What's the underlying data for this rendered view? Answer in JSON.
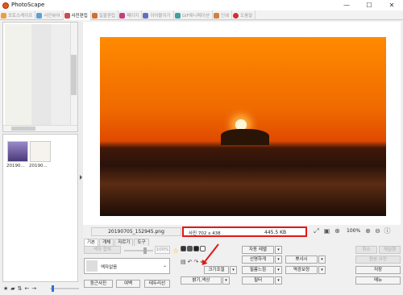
{
  "window": {
    "title": "PhotoScape",
    "minimize": "—",
    "maximize": "☐",
    "close": "✕"
  },
  "tabs": [
    {
      "label": "포토스케이프",
      "color": "#e8a040",
      "active": false
    },
    {
      "label": "사진뷰어",
      "color": "#5aa0d8",
      "active": false
    },
    {
      "label": "사진편집",
      "color": "#c85050",
      "active": true
    },
    {
      "label": "일괄편집",
      "color": "#d07030",
      "active": false
    },
    {
      "label": "페이지",
      "color": "#c04080",
      "active": false
    },
    {
      "label": "이어붙이기",
      "color": "#6070c0",
      "active": false
    },
    {
      "label": "GIF애니메이션",
      "color": "#40a0a0",
      "active": false
    },
    {
      "label": "인쇄",
      "color": "#d08040",
      "active": false
    },
    {
      "label": "도움말",
      "color": "#d03030",
      "active": false
    }
  ],
  "thumbnails": [
    {
      "label": "20190...",
      "color": "#6a5a9a"
    },
    {
      "label": "20190...",
      "color": "#f6f2ee"
    }
  ],
  "status": {
    "filename": "20190705_152945.png",
    "size_text": "사진 702 x 438",
    "file_size": "445.5 KB",
    "zoom": "100%",
    "highlight_color": "#e01818"
  },
  "subtabs": [
    {
      "label": "기본",
      "active": true
    },
    {
      "label": "개체",
      "active": false
    },
    {
      "label": "자르기",
      "active": false
    },
    {
      "label": "도구",
      "active": false
    }
  ],
  "panel": {
    "frame_merge": "액자 합쳐",
    "frame_pct": "100%",
    "frame_name": "액자없음",
    "rounded_photo": "둥근사진",
    "margin": "여백",
    "frame_line": "테두리선",
    "auto_level": "자동 레벨",
    "sharpen": "선명하게",
    "saturation": "필름느낌",
    "brightness_color": "밝기,색상",
    "filter": "필터",
    "resize": "크기조절",
    "backlight": "역광보정",
    "bloom": "뽀샤시",
    "undo": "취소",
    "redo": "재실행",
    "restore": "원본 사진",
    "save": "저장",
    "menu": "메뉴"
  },
  "icons": {
    "zoom_fit": "fit-icon",
    "zoom_actual": "actual-size-icon",
    "zoom_in": "zoom-in-icon",
    "zoom_out": "zoom-out-icon",
    "info": "info-icon"
  }
}
